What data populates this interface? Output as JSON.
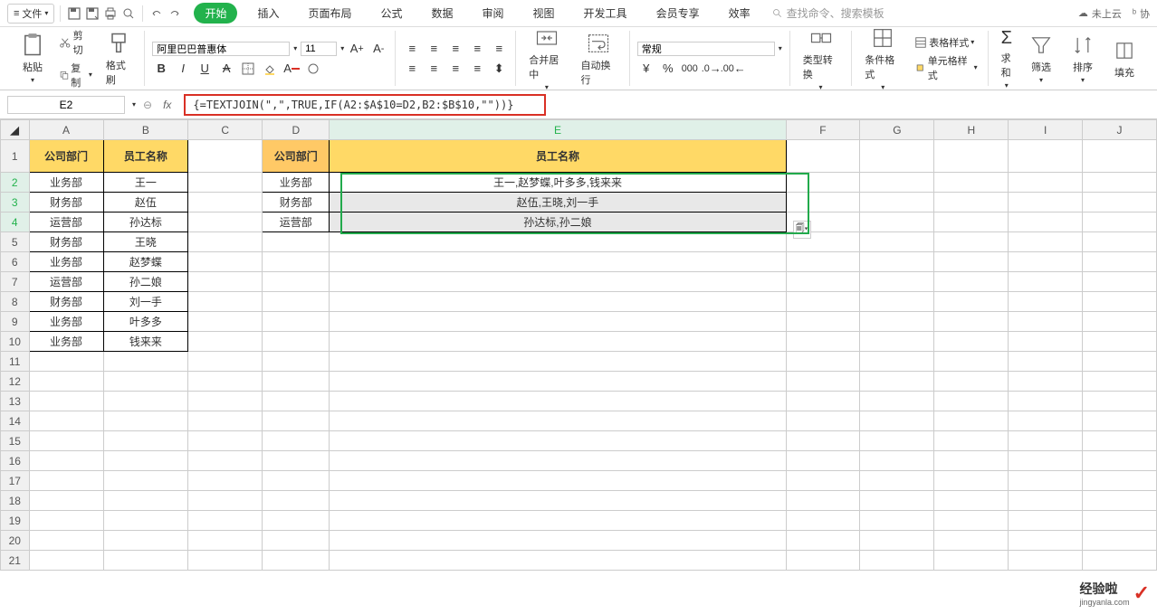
{
  "menu": {
    "file": "文件",
    "tabs": [
      "开始",
      "插入",
      "页面布局",
      "公式",
      "数据",
      "审阅",
      "视图",
      "开发工具",
      "会员专享",
      "效率"
    ],
    "search_placeholder": "查找命令、搜索模板",
    "cloud": "未上云",
    "collab": "协"
  },
  "ribbon": {
    "paste": "粘贴",
    "cut": "剪切",
    "copy": "复制",
    "format_painter": "格式刷",
    "font": "阿里巴巴普惠体",
    "font_size": "11",
    "merge": "合并居中",
    "wrap": "自动换行",
    "num_fmt": "常规",
    "type_convert": "类型转换",
    "cond_fmt": "条件格式",
    "table_style": "表格样式",
    "cell_style": "单元格样式",
    "sum": "求和",
    "filter": "筛选",
    "sort": "排序",
    "fill": "填充"
  },
  "formula": {
    "cell_ref": "E2",
    "value": "{=TEXTJOIN(\",\",TRUE,IF(A2:$A$10=D2,B2:$B$10,\"\"))}"
  },
  "columns": [
    "A",
    "B",
    "C",
    "D",
    "E",
    "F",
    "G",
    "H",
    "I",
    "J"
  ],
  "table1": {
    "hdr": [
      "公司部门",
      "员工名称"
    ],
    "rows": [
      [
        "业务部",
        "王一"
      ],
      [
        "财务部",
        "赵伍"
      ],
      [
        "运营部",
        "孙达标"
      ],
      [
        "财务部",
        "王晓"
      ],
      [
        "业务部",
        "赵梦蝶"
      ],
      [
        "运营部",
        "孙二娘"
      ],
      [
        "财务部",
        "刘一手"
      ],
      [
        "业务部",
        "叶多多"
      ],
      [
        "业务部",
        "钱来来"
      ]
    ]
  },
  "table2": {
    "hdr": [
      "公司部门",
      "员工名称"
    ],
    "rows": [
      [
        "业务部",
        "王一,赵梦蝶,叶多多,钱来来"
      ],
      [
        "财务部",
        "赵伍,王晓,刘一手"
      ],
      [
        "运营部",
        "孙达标,孙二娘"
      ]
    ]
  },
  "watermark": {
    "main": "经验啦",
    "sub": "jingyanla.com"
  }
}
